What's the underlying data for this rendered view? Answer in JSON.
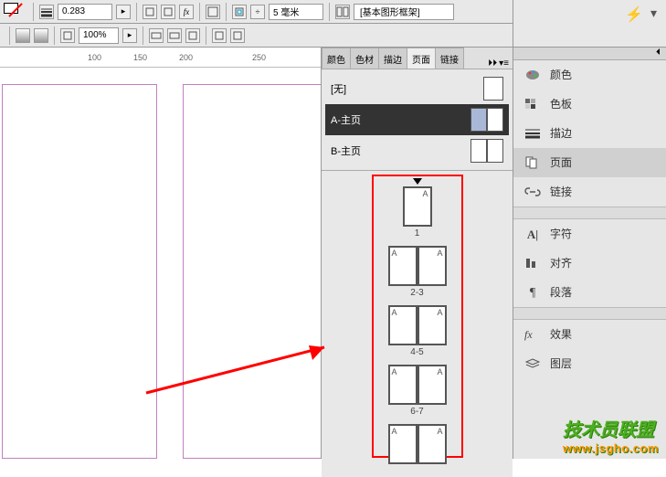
{
  "toolbar": {
    "stroke_weight": "0.283",
    "zoom": "100%",
    "size_val": "5 毫米",
    "frame_preset": "[基本图形框架]"
  },
  "ruler": {
    "marks": [
      {
        "pos": 100,
        "label": "100"
      },
      {
        "pos": 150,
        "label": "150"
      },
      {
        "pos": 200,
        "label": "200"
      },
      {
        "pos": 250,
        "label": ""
      },
      {
        "pos": 300,
        "label": "250"
      }
    ]
  },
  "pages_panel": {
    "tabs": [
      "颜色",
      "色材",
      "描边",
      "页面",
      "链接"
    ],
    "active_tab": "页面",
    "masters": [
      {
        "name": "[无]",
        "selected": false,
        "single": true
      },
      {
        "name": "A-主页",
        "selected": true,
        "blue_left": true
      },
      {
        "name": "B-主页",
        "selected": false
      }
    ],
    "pages": [
      {
        "label": "1",
        "single": true
      },
      {
        "label": "2-3"
      },
      {
        "label": "4-5"
      },
      {
        "label": "6-7"
      },
      {
        "label": ""
      }
    ],
    "corner_mark": "A"
  },
  "rail": {
    "groups": [
      {
        "items": [
          {
            "icon": "palette",
            "label": "颜色"
          },
          {
            "icon": "swatches",
            "label": "色板"
          },
          {
            "icon": "stroke",
            "label": "描边"
          },
          {
            "icon": "pages",
            "label": "页面",
            "active": true
          },
          {
            "icon": "links",
            "label": "链接"
          }
        ]
      },
      {
        "items": [
          {
            "icon": "char",
            "label": "字符"
          },
          {
            "icon": "align",
            "label": "对齐"
          },
          {
            "icon": "para",
            "label": "段落"
          }
        ]
      },
      {
        "items": [
          {
            "icon": "fx",
            "label": "效果"
          },
          {
            "icon": "layers",
            "label": "图层"
          }
        ]
      }
    ]
  },
  "watermark": {
    "big": "技术员联盟",
    "url": "www.jsgho.com"
  }
}
